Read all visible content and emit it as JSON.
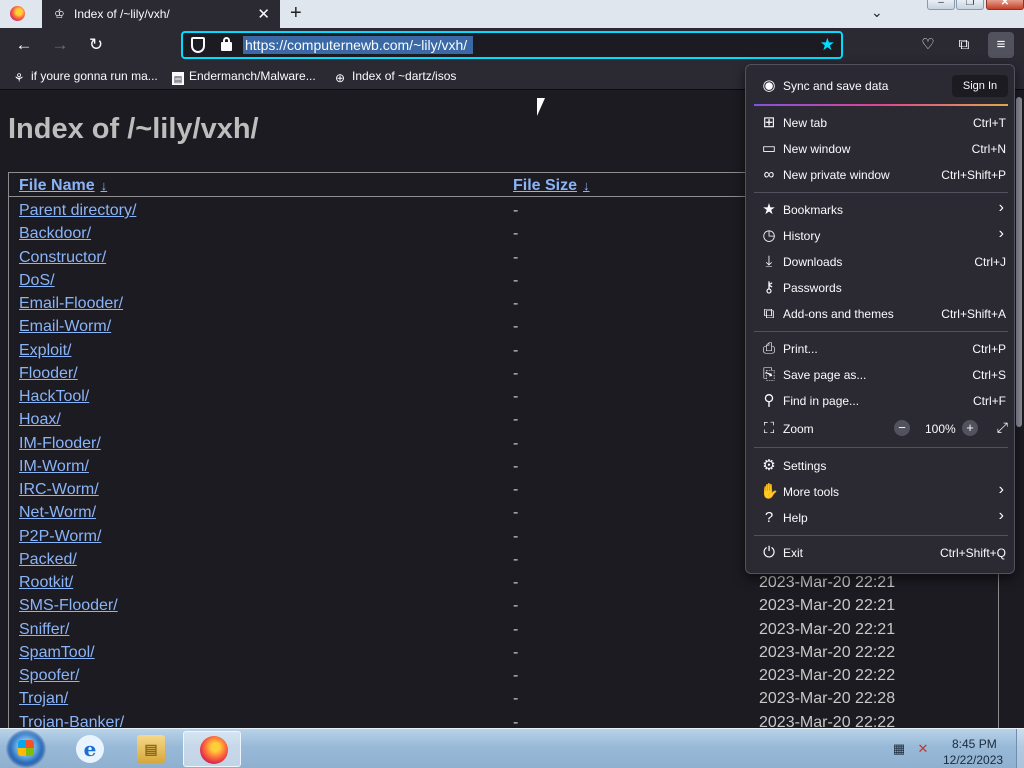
{
  "browser": {
    "tab": {
      "title": "Index of /~lily/vxh/"
    },
    "url": "https://computernewb.com/~lily/vxh/",
    "bookmarks": [
      {
        "label": "if youre gonna run ma...",
        "icon": "mushroom-icon"
      },
      {
        "label": "Endermanch/Malware...",
        "icon": "page-icon"
      },
      {
        "label": "Index of ~dartz/isos",
        "icon": "globe-icon"
      }
    ]
  },
  "page": {
    "heading": "Index of /~lily/vxh/",
    "columns": {
      "name": "File Name",
      "size": "File Size",
      "sort_glyph": "↓"
    },
    "rows": [
      {
        "name": "Parent directory/",
        "size": "-",
        "date": ""
      },
      {
        "name": "Backdoor/",
        "size": "-",
        "date": ""
      },
      {
        "name": "Constructor/",
        "size": "-",
        "date": ""
      },
      {
        "name": "DoS/",
        "size": "-",
        "date": ""
      },
      {
        "name": "Email-Flooder/",
        "size": "-",
        "date": ""
      },
      {
        "name": "Email-Worm/",
        "size": "-",
        "date": ""
      },
      {
        "name": "Exploit/",
        "size": "-",
        "date": ""
      },
      {
        "name": "Flooder/",
        "size": "-",
        "date": ""
      },
      {
        "name": "HackTool/",
        "size": "-",
        "date": ""
      },
      {
        "name": "Hoax/",
        "size": "-",
        "date": ""
      },
      {
        "name": "IM-Flooder/",
        "size": "-",
        "date": ""
      },
      {
        "name": "IM-Worm/",
        "size": "-",
        "date": ""
      },
      {
        "name": "IRC-Worm/",
        "size": "-",
        "date": ""
      },
      {
        "name": "Net-Worm/",
        "size": "-",
        "date": ""
      },
      {
        "name": "P2P-Worm/",
        "size": "-",
        "date": ""
      },
      {
        "name": "Packed/",
        "size": "-",
        "date": ""
      },
      {
        "name": "Rootkit/",
        "size": "-",
        "date": "2023-Mar-20 22:21"
      },
      {
        "name": "SMS-Flooder/",
        "size": "-",
        "date": "2023-Mar-20 22:21"
      },
      {
        "name": "Sniffer/",
        "size": "-",
        "date": "2023-Mar-20 22:21"
      },
      {
        "name": "SpamTool/",
        "size": "-",
        "date": "2023-Mar-20 22:22"
      },
      {
        "name": "Spoofer/",
        "size": "-",
        "date": "2023-Mar-20 22:22"
      },
      {
        "name": "Trojan/",
        "size": "-",
        "date": "2023-Mar-20 22:28"
      },
      {
        "name": "Trojan-Banker/",
        "size": "-",
        "date": "2023-Mar-20 22:22"
      }
    ]
  },
  "app_menu": {
    "sync": {
      "label": "Sync and save data",
      "button": "Sign In"
    },
    "items": {
      "new_tab": {
        "label": "New tab",
        "shortcut": "Ctrl+T"
      },
      "new_window": {
        "label": "New window",
        "shortcut": "Ctrl+N"
      },
      "private_window": {
        "label": "New private window",
        "shortcut": "Ctrl+Shift+P"
      },
      "bookmarks": {
        "label": "Bookmarks"
      },
      "history": {
        "label": "History"
      },
      "downloads": {
        "label": "Downloads",
        "shortcut": "Ctrl+J"
      },
      "passwords": {
        "label": "Passwords"
      },
      "addons": {
        "label": "Add-ons and themes",
        "shortcut": "Ctrl+Shift+A"
      },
      "print": {
        "label": "Print...",
        "shortcut": "Ctrl+P"
      },
      "save_page": {
        "label": "Save page as...",
        "shortcut": "Ctrl+S"
      },
      "find": {
        "label": "Find in page...",
        "shortcut": "Ctrl+F"
      },
      "zoom": {
        "label": "Zoom",
        "level": "100%"
      },
      "settings": {
        "label": "Settings"
      },
      "more_tools": {
        "label": "More tools"
      },
      "help": {
        "label": "Help"
      },
      "exit": {
        "label": "Exit",
        "shortcut": "Ctrl+Shift+Q"
      }
    }
  },
  "taskbar": {
    "apps": [
      "ie-icon",
      "file-explorer-icon",
      "firefox-icon"
    ],
    "clock": {
      "time": "8:45 PM",
      "date": "12/22/2023"
    }
  },
  "colors": {
    "accent": "#00ddff",
    "link": "#8ab4f8",
    "page_bg": "#1c1b22",
    "chrome_bg": "#2b2a33"
  }
}
